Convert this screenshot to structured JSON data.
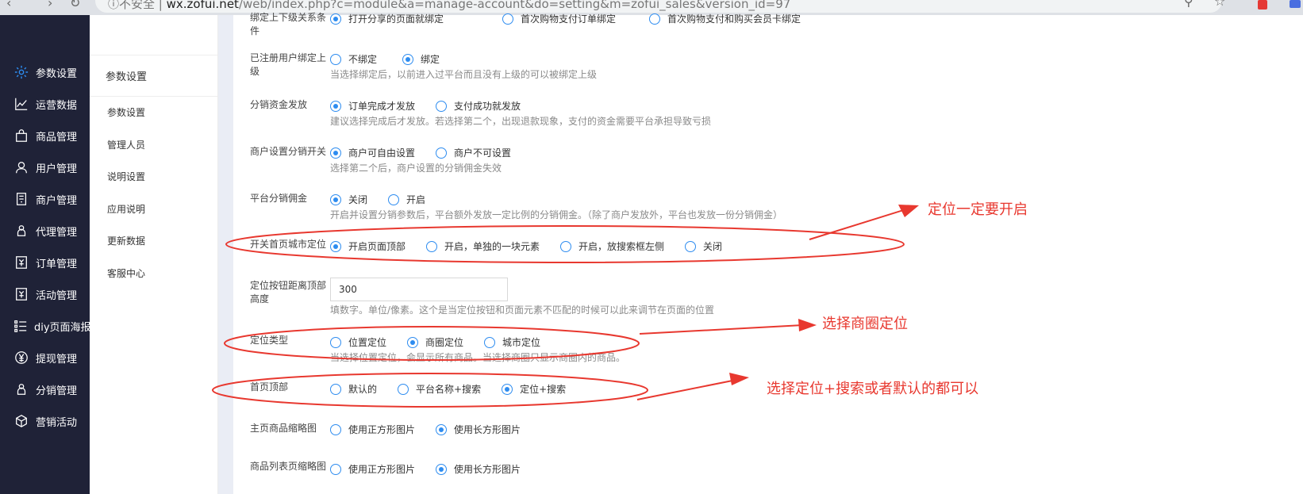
{
  "browser": {
    "url_secure": "不安全",
    "url_domain": "wx.zofui.net",
    "url_path": "/web/index.php?c=module&a=manage-account&do=setting&m=zofui_sales&version_id=97"
  },
  "sidebar": {
    "items": [
      {
        "label": "参数设置",
        "icon": "gear-icon"
      },
      {
        "label": "运营数据",
        "icon": "line-chart-icon"
      },
      {
        "label": "商品管理",
        "icon": "bag-icon"
      },
      {
        "label": "用户管理",
        "icon": "user-icon"
      },
      {
        "label": "商户管理",
        "icon": "store-icon"
      },
      {
        "label": "代理管理",
        "icon": "agent-icon"
      },
      {
        "label": "订单管理",
        "icon": "order-icon"
      },
      {
        "label": "活动管理",
        "icon": "activity-icon"
      },
      {
        "label": "diy页面海报",
        "icon": "list-icon"
      },
      {
        "label": "提现管理",
        "icon": "yen-icon"
      },
      {
        "label": "分销管理",
        "icon": "distribution-icon"
      },
      {
        "label": "营销活动",
        "icon": "cube-icon"
      }
    ]
  },
  "subnav": {
    "title": "参数设置",
    "items": [
      "参数设置",
      "管理人员",
      "说明设置",
      "应用说明",
      "更新数据",
      "客服中心"
    ]
  },
  "form": {
    "rows": [
      {
        "label": "绑定上下级关系条件",
        "options": [
          "打开分享的页面就绑定",
          "首次购物支付订单绑定",
          "首次购物支付和购买会员卡绑定"
        ],
        "selected": 0
      },
      {
        "label": "已注册用户绑定上级",
        "options": [
          "不绑定",
          "绑定"
        ],
        "selected": 1,
        "hint": "当选择绑定后，以前进入过平台而且没有上级的可以被绑定上级"
      },
      {
        "label": "分销资金发放",
        "options": [
          "订单完成才发放",
          "支付成功就发放"
        ],
        "selected": 0,
        "hint": "建议选择完成后才发放。若选择第二个，出现退款现象，支付的资金需要平台承担导致亏损"
      },
      {
        "label": "商户设置分销开关",
        "options": [
          "商户可自由设置",
          "商户不可设置"
        ],
        "selected": 0,
        "hint": "选择第二个后，商户设置的分销佣金失效"
      },
      {
        "label": "平台分销佣金",
        "options": [
          "关闭",
          "开启"
        ],
        "selected": 0,
        "hint": "开启并设置分销参数后，平台额外发放一定比例的分销佣金。（除了商户发放外，平台也发放一份分销佣金）"
      },
      {
        "label": "开关首页城市定位",
        "options": [
          "开启页面顶部",
          "开启，单独的一块元素",
          "开启，放搜索框左侧",
          "关闭"
        ],
        "selected": 0
      },
      {
        "label": "定位按钮距离顶部高度",
        "input_value": "300",
        "hint": "填数字。单位/像素。这个是当定位按钮和页面元素不匹配的时候可以此来调节在页面的位置"
      },
      {
        "label": "定位类型",
        "options": [
          "位置定位",
          "商圈定位",
          "城市定位"
        ],
        "selected": 1,
        "hint": "当选择位置定位，会显示所有商品。当选择商圈只显示商圈内的商品。"
      },
      {
        "label": "首页顶部",
        "options": [
          "默认的",
          "平台名称+搜索",
          "定位+搜索"
        ],
        "selected": 2
      },
      {
        "label": "主页商品缩略图",
        "options": [
          "使用正方形图片",
          "使用长方形图片"
        ],
        "selected": 1
      },
      {
        "label": "商品列表页缩略图",
        "options": [
          "使用正方形图片",
          "使用长方形图片"
        ],
        "selected": 1
      }
    ]
  },
  "annotations": {
    "a1": "定位一定要开启",
    "a2": "选择商圈定位",
    "a3": "选择定位+搜索或者默认的都可以",
    "color": "#e8382f"
  },
  "colors": {
    "sidebar_bg": "#1f2237",
    "accent": "#2d8cf0"
  }
}
